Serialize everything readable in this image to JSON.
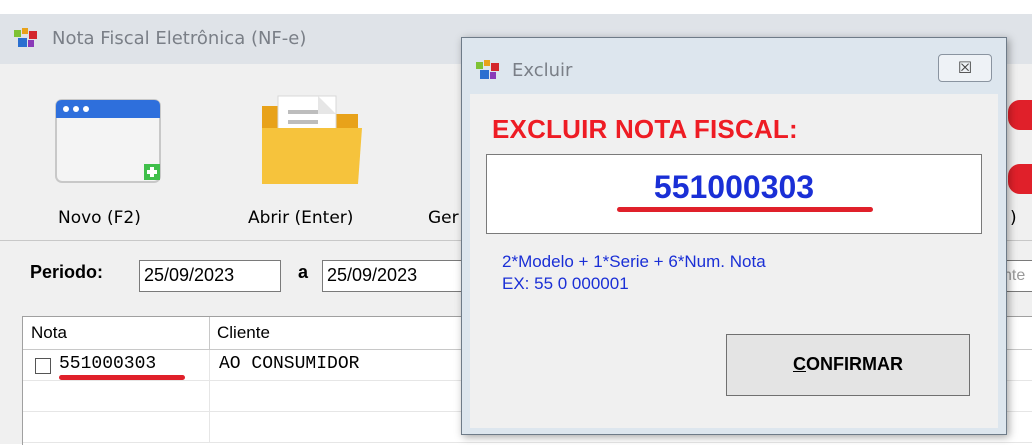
{
  "main_window": {
    "title": "Nota Fiscal Eletrônica (NF-e)",
    "icon": "app-logo-icon",
    "toolbar": {
      "new_label": "Novo (F2)",
      "open_label": "Abrir (Enter)",
      "partial_label": "Ger",
      "right_partial_label": ")"
    },
    "period": {
      "label": "Periodo:",
      "from": "25/09/2023",
      "separator": "a",
      "to": "25/09/2023",
      "search_partial": "nte"
    },
    "table": {
      "columns": [
        "Nota",
        "Cliente"
      ],
      "rows": [
        {
          "nota": "551000303",
          "cliente": "AO CONSUMIDOR"
        }
      ]
    }
  },
  "dialog": {
    "title": "Excluir",
    "close_symbol": "☒",
    "heading": "EXCLUIR NOTA FISCAL:",
    "input_value": "551000303",
    "hint_line1": "2*Modelo + 1*Serie + 6*Num. Nota",
    "hint_line2": "EX:  55 0 000001",
    "confirm_first_letter": "C",
    "confirm_rest": "ONFIRMAR"
  },
  "colors": {
    "accent_red": "#ee1c24",
    "value_blue": "#1a2fd6"
  }
}
